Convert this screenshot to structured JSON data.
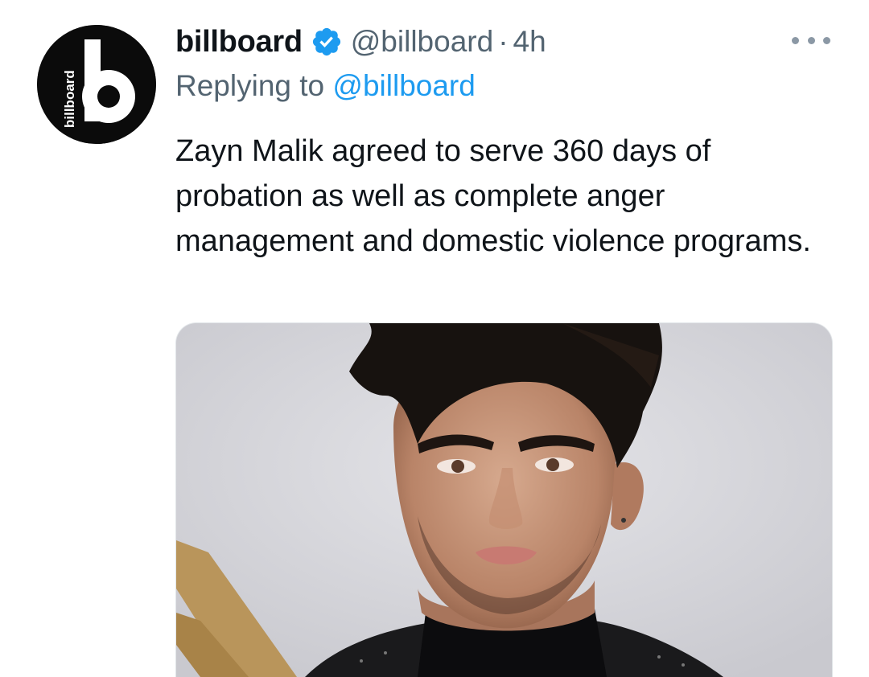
{
  "tweet": {
    "author_name": "billboard",
    "handle": "@billboard",
    "separator": "·",
    "time": "4h",
    "avatar_text": "billboard",
    "avatar_letter": "b",
    "reply_prefix": "Replying to",
    "reply_mention": "@billboard",
    "text": "Zayn Malik agreed to serve 360 days of probation as well as complete anger management and domestic violence programs.",
    "verified_icon": "verified-badge-icon",
    "more_icon": "more-options-icon"
  },
  "colors": {
    "text_primary": "#0f1419",
    "text_secondary": "#536471",
    "link": "#1d9bf0",
    "verified": "#1d9bf0",
    "avatar_bg": "#0b0b0b"
  }
}
